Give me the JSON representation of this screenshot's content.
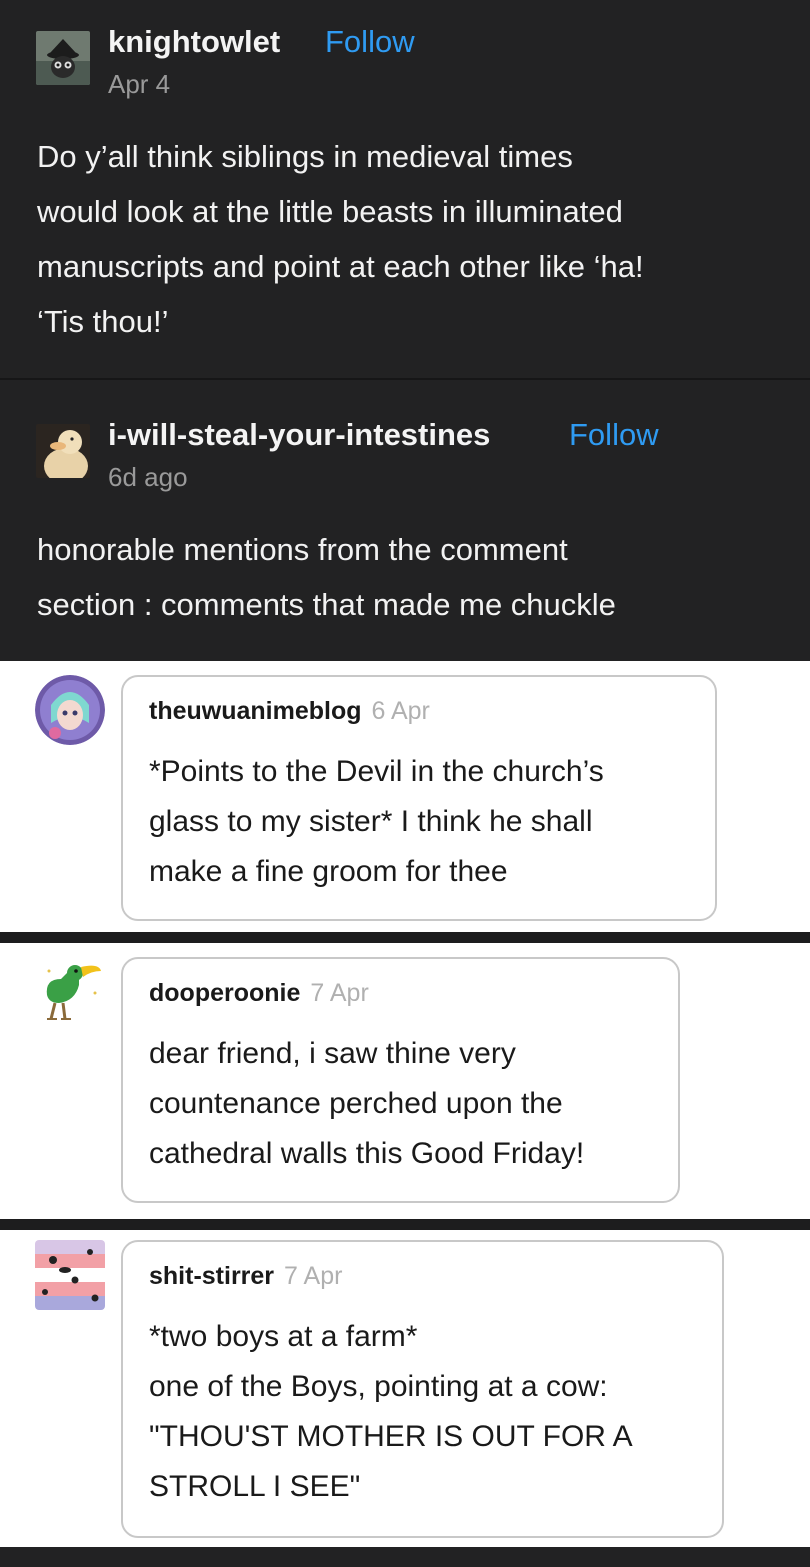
{
  "posts": [
    {
      "username": "knightowlet",
      "follow_label": "Follow",
      "date": "Apr 4",
      "lines": [
        "Do y’all think siblings in medieval times",
        "would look at the little beasts in illuminated",
        "manuscripts and point at each other like ‘ha!",
        "‘Tis thou!’"
      ],
      "avatar_icon": "owl-avatar-icon"
    },
    {
      "username": "i-will-steal-your-intestines",
      "follow_label": "Follow",
      "date": "6d ago",
      "lines": [
        "honorable mentions from the comment",
        "section : comments that made me chuckle"
      ],
      "avatar_icon": "duck-avatar-icon"
    }
  ],
  "comments": [
    {
      "username": "theuwuanimeblog",
      "date": "6 Apr",
      "lines": [
        "*Points to the Devil in the church’s",
        "glass to my sister* I think he shall",
        "make a fine groom for thee"
      ],
      "avatar_icon": "anime-girl-avatar-icon"
    },
    {
      "username": "dooperoonie",
      "date": "7 Apr",
      "lines": [
        "dear friend, i saw thine very",
        "countenance perched upon the",
        "cathedral walls this Good Friday!"
      ],
      "avatar_icon": "green-bird-avatar-icon"
    },
    {
      "username": "shit-stirrer",
      "date": "7 Apr",
      "lines": [
        "*two boys at a farm*",
        "one of the Boys, pointing at a cow:",
        "\"THOU'ST MOTHER IS OUT FOR A",
        "STROLL I SEE\""
      ],
      "avatar_icon": "striped-flag-avatar-icon"
    }
  ],
  "colors": {
    "background": "#222223",
    "follow_blue": "#2f9bf2",
    "comment_background": "#ffffff"
  }
}
